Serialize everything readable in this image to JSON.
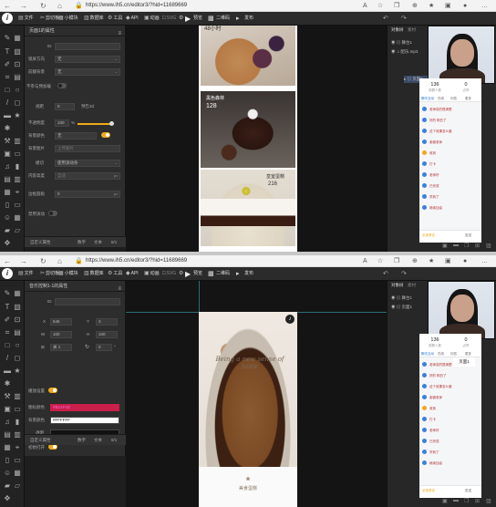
{
  "browser": {
    "url": "https://www.ih5.cn/editor3/?hid=11689669"
  },
  "toolbar": {
    "items": [
      {
        "icon": "file-icon",
        "label": "文件"
      },
      {
        "icon": "cut-icon",
        "label": "剪切板"
      },
      {
        "icon": "component-icon",
        "label": "小模块"
      },
      {
        "icon": "data-icon",
        "label": "数据库"
      },
      {
        "icon": "tool-icon",
        "label": "工具"
      },
      {
        "icon": "api-icon",
        "label": "API"
      },
      {
        "icon": "animation-icon",
        "label": "动画"
      },
      {
        "icon": "svg-icon",
        "label": "SVG"
      },
      {
        "icon": "script-icon",
        "label": "动效"
      }
    ],
    "preview": "预览",
    "qrcode": "二维码",
    "publish": "发布"
  },
  "screen1": {
    "panel_title": "页面1的属性",
    "rows": {
      "id_label": "ID",
      "position_label": "锁屏方向",
      "position_value": "无",
      "background_label": "前翻背景",
      "background_value": "无",
      "lock_label": "不参与预加载",
      "scroll_label": "视距",
      "scroll_value": "0",
      "scroll_3d": "预告3d",
      "opacity_label": "不透明度",
      "opacity_value": "100",
      "opacity_unit": "%",
      "bgcolor_label": "背景颜色",
      "bgcolor_value": "无",
      "bgimg_label": "背景图片",
      "bgimg_value": "上传图片",
      "mode_label": "模切",
      "mode_value": "使用滚动条",
      "content_label": "内容高度",
      "content_value": "自适",
      "content_unit": "px",
      "edge_label": "边框圆角",
      "edge_value": "0",
      "edge_unit": "px",
      "drag_label": "禁用滚动"
    },
    "footer": {
      "custom": "自定义属性",
      "data": "数字",
      "text": "文本",
      "extra": "8/1"
    },
    "phone_texts": {
      "t1": "48小时",
      "t2": "黑色森林",
      "t3": "128",
      "t4": "皇室蛋糕",
      "t5": "216"
    }
  },
  "screen2": {
    "panel_title": "音乐控制1-1的属性",
    "rows": {
      "id_label": "ID",
      "x_label": "X",
      "x_value": "546",
      "y_label": "Y",
      "y_value": "3",
      "w_label": "W",
      "w_value": "100",
      "h_label": "H",
      "h_value": "100",
      "scale_value": "关 1",
      "rot_value": "0",
      "rot_unit": "°",
      "play_label": "播放设置",
      "color_label": "图标颜色",
      "color_value": "#B21F4D",
      "bg_label": "背景颜色",
      "bg_value": "#FFFFFF",
      "transp_label": "透明",
      "init_label": "初始打开"
    },
    "footer": {
      "custom": "自定义属性",
      "data": "数字",
      "text": "文本",
      "extra": "8/1"
    },
    "phone_texts": {
      "script": "Being a new sense of taste",
      "brand": "美食蛋糕"
    },
    "popup": "页面1"
  },
  "right_panel": {
    "tabs": [
      "对象树",
      "素材"
    ],
    "tree": [
      "舞台1",
      "页面1",
      "配乐.mp3"
    ],
    "chat": {
      "stat1": "136",
      "stat1_label": "观看人数",
      "stat2": "0",
      "stat2_label": "点赞",
      "tabs": [
        "聊天互动",
        "在线",
        "问答",
        "更多"
      ],
      "messages": [
        "老师讲的很清楚",
        "好的 明白了",
        "这个效果怎么做",
        "谢谢老师",
        "收到",
        "打卡",
        "老师好",
        "已完成",
        "学到了",
        "继续加油"
      ],
      "footer_a": "全体禁言",
      "footer_b": "发送"
    }
  }
}
